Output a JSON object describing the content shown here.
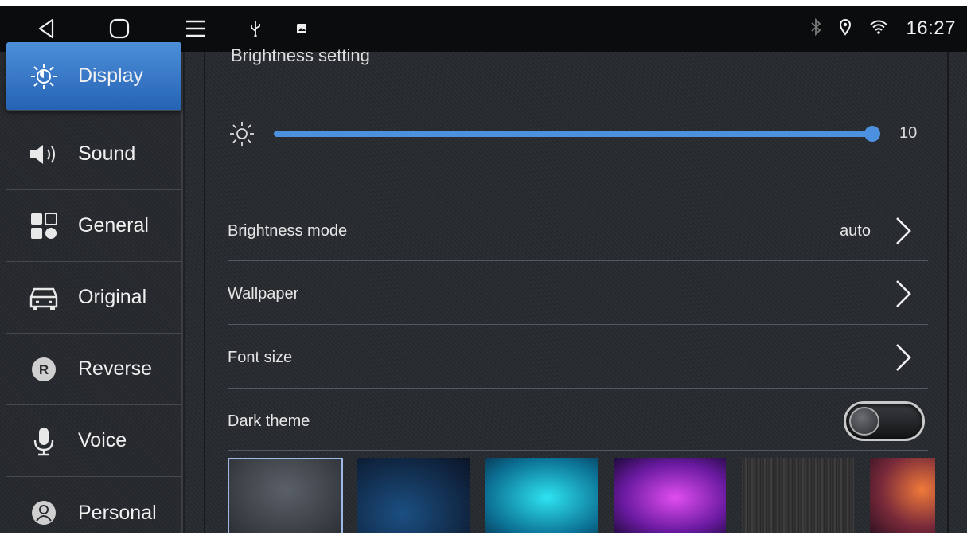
{
  "status_bar": {
    "time": "16:27",
    "icons": [
      "back-icon",
      "home-icon",
      "menu-icon",
      "usb-icon",
      "image-icon",
      "bluetooth-icon",
      "location-icon",
      "wifi-icon"
    ]
  },
  "sidebar": {
    "items": [
      {
        "label": "Display",
        "icon": "sun-icon",
        "active": true
      },
      {
        "label": "Sound",
        "icon": "speaker-icon"
      },
      {
        "label": "General",
        "icon": "grid-icon"
      },
      {
        "label": "Original",
        "icon": "car-icon"
      },
      {
        "label": "Reverse",
        "icon": "reverse-r-icon"
      },
      {
        "label": "Voice",
        "icon": "microphone-icon"
      },
      {
        "label": "Personal",
        "icon": "person-icon"
      }
    ]
  },
  "main": {
    "section_title": "Brightness setting",
    "brightness": {
      "value": "10",
      "level": 1.0
    },
    "rows": [
      {
        "label": "Brightness mode",
        "value": "auto"
      },
      {
        "label": "Wallpaper",
        "value": ""
      },
      {
        "label": "Font size",
        "value": ""
      },
      {
        "label": "Dark theme",
        "toggle": false
      }
    ],
    "wallpapers": [
      "#3a3f46",
      "#10203a",
      "#1aa0c8",
      "#8a1fa8",
      "#2a2a2a",
      "#7a3a3a"
    ]
  },
  "colors": {
    "accent": "#4d90e0",
    "sidebar_active": "#2e6fc0"
  }
}
